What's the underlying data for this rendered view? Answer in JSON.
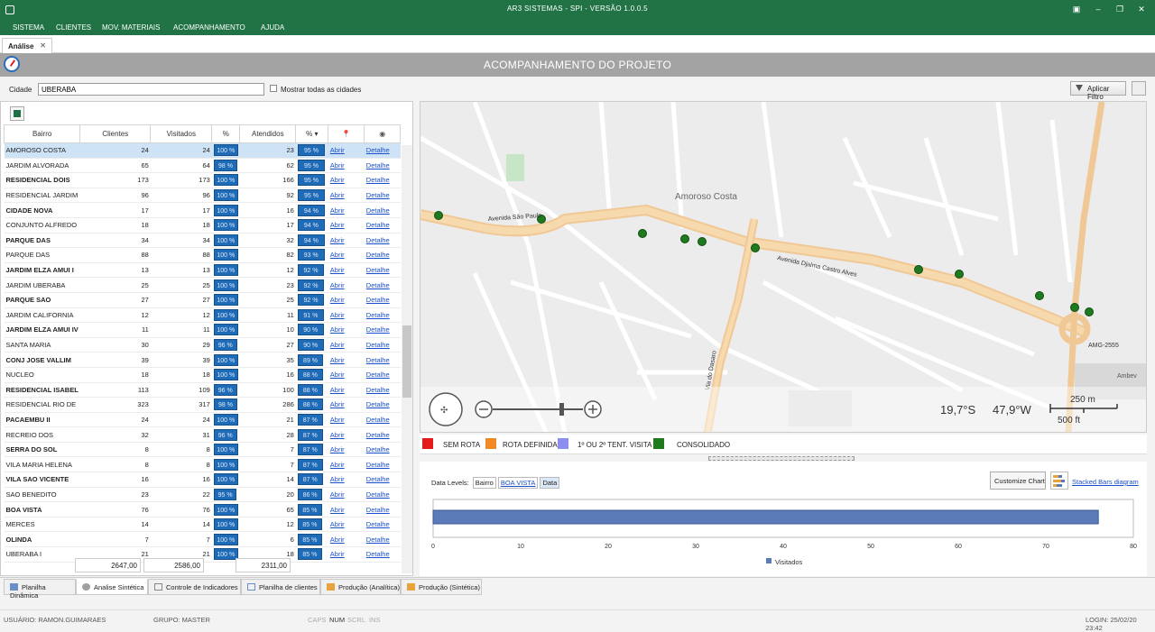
{
  "window": {
    "title": "AR3 SISTEMAS - SPI -  VERSÃO 1.0.0.5"
  },
  "menu": [
    "SISTEMA",
    "CLIENTES",
    "MOV. MATERIAIS",
    "ACOMPANHAMENTO",
    "AJUDA"
  ],
  "doc_tab": {
    "label": "Análise"
  },
  "header": {
    "title": "ACOMPANHAMENTO DO PROJETO"
  },
  "filter": {
    "city_label": "Cidade",
    "city_value": "UBERABA",
    "show_all_label": "Mostrar todas as cidades",
    "apply_label": "Aplicar Filtro"
  },
  "grid": {
    "columns": [
      "Bairro",
      "Clientes",
      "Visitados",
      "%",
      "Atendidos",
      "%"
    ],
    "link_open": "Abrir",
    "link_detail": "Detalhe",
    "rows": [
      [
        "AMOROSO COSTA",
        "24",
        "24",
        "100 %",
        "23",
        "95 %"
      ],
      [
        "JARDIM ALVORADA",
        "65",
        "64",
        "98 %",
        "62",
        "95 %"
      ],
      [
        "RESIDENCIAL DOIS",
        "173",
        "173",
        "100 %",
        "166",
        "95 %"
      ],
      [
        "RESIDENCIAL JARDIM",
        "96",
        "96",
        "100 %",
        "92",
        "95 %"
      ],
      [
        "CIDADE NOVA",
        "17",
        "17",
        "100 %",
        "16",
        "94 %"
      ],
      [
        "CONJUNTO ALFREDO",
        "18",
        "18",
        "100 %",
        "17",
        "94 %"
      ],
      [
        "PARQUE DAS",
        "34",
        "34",
        "100 %",
        "32",
        "94 %"
      ],
      [
        "PARQUE DAS",
        "88",
        "88",
        "100 %",
        "82",
        "93 %"
      ],
      [
        "JARDIM ELZA AMUI I",
        "13",
        "13",
        "100 %",
        "12",
        "92 %"
      ],
      [
        "JARDIM UBERABA",
        "25",
        "25",
        "100 %",
        "23",
        "92 %"
      ],
      [
        "PARQUE SAO",
        "27",
        "27",
        "100 %",
        "25",
        "92 %"
      ],
      [
        "JARDIM CALIFORNIA",
        "12",
        "12",
        "100 %",
        "11",
        "91 %"
      ],
      [
        "JARDIM ELZA AMUI IV",
        "11",
        "11",
        "100 %",
        "10",
        "90 %"
      ],
      [
        "SANTA MARIA",
        "30",
        "29",
        "96 %",
        "27",
        "90 %"
      ],
      [
        "CONJ JOSE VALLIM",
        "39",
        "39",
        "100 %",
        "35",
        "89 %"
      ],
      [
        "NUCLEO",
        "18",
        "18",
        "100 %",
        "16",
        "88 %"
      ],
      [
        "RESIDENCIAL ISABEL",
        "113",
        "109",
        "96 %",
        "100",
        "88 %"
      ],
      [
        "RESIDENCIAL RIO DE",
        "323",
        "317",
        "98 %",
        "286",
        "88 %"
      ],
      [
        "PACAEMBU II",
        "24",
        "24",
        "100 %",
        "21",
        "87 %"
      ],
      [
        "RECREIO DOS",
        "32",
        "31",
        "96 %",
        "28",
        "87 %"
      ],
      [
        "SERRA DO SOL",
        "8",
        "8",
        "100 %",
        "7",
        "87 %"
      ],
      [
        "VILA MARIA HELENA",
        "8",
        "8",
        "100 %",
        "7",
        "87 %"
      ],
      [
        "VILA SAO VICENTE",
        "16",
        "16",
        "100 %",
        "14",
        "87 %"
      ],
      [
        "SAO BENEDITO",
        "23",
        "22",
        "95 %",
        "20",
        "86 %"
      ],
      [
        "BOA VISTA",
        "76",
        "76",
        "100 %",
        "65",
        "85 %"
      ],
      [
        "MERCES",
        "14",
        "14",
        "100 %",
        "12",
        "85 %"
      ],
      [
        "OLINDA",
        "7",
        "7",
        "100 %",
        "6",
        "85 %"
      ],
      [
        "UBERABA I",
        "21",
        "21",
        "100 %",
        "18",
        "85 %"
      ]
    ],
    "totals": {
      "clientes": "2647,00",
      "visitados": "2586,00",
      "atendidos": "2311,00"
    }
  },
  "map": {
    "district_label": "Amoroso Costa",
    "roads": {
      "main": "Avenida Djalma Castro Alves",
      "sao_paulo": "Avenida São Paulo",
      "dasaro": "Via do Dasaro",
      "amg": "AMG-2555",
      "ambev": "Ambev"
    },
    "scale_m": "250 m",
    "scale_ft": "500 ft",
    "coord_lat": "19,7°S",
    "coord_lon": "47,9°W"
  },
  "legend": [
    {
      "label": "SEM ROTA",
      "color": "#e31b1b"
    },
    {
      "label": "ROTA DEFINIDA",
      "color": "#f08a24"
    },
    {
      "label": "1º OU 2º TENT. VISITA",
      "color": "#8e8ef0"
    },
    {
      "label": "CONSOLIDADO",
      "color": "#1f7a1f"
    }
  ],
  "chart_panel": {
    "data_levels_label": "Data Levels:",
    "levels": [
      "Bairro",
      "BOA VISTA",
      "Data"
    ],
    "customize_label": "Customize Chart",
    "stacked_label": "Stacked Bars diagram"
  },
  "chart_data": {
    "type": "bar",
    "orientation": "horizontal",
    "categories": [
      "BOA VISTA"
    ],
    "series": [
      {
        "name": "Visitados",
        "values": [
          76
        ],
        "color": "#5a7ab8"
      }
    ],
    "xlim": [
      0,
      80
    ],
    "xticks": [
      "0",
      "10",
      "20",
      "30",
      "40",
      "50",
      "60",
      "70",
      "80"
    ],
    "grid": false,
    "legend": "bottom"
  },
  "bottom_tabs": [
    "Planilha Dinâmica",
    "Analise Sintética",
    "Controle de Indicadores",
    "Planilha de clientes",
    "Produção (Analítica)",
    "Produção (Sintética)"
  ],
  "status": {
    "user": "USUÁRIO: RAMON.GUIMARAES",
    "group": "GRUPO: MASTER",
    "caps": "CAPS",
    "num": "NUM",
    "scrl": "SCRL",
    "ins": "INS",
    "login": "LOGIN: 25/02/20 23:42"
  }
}
